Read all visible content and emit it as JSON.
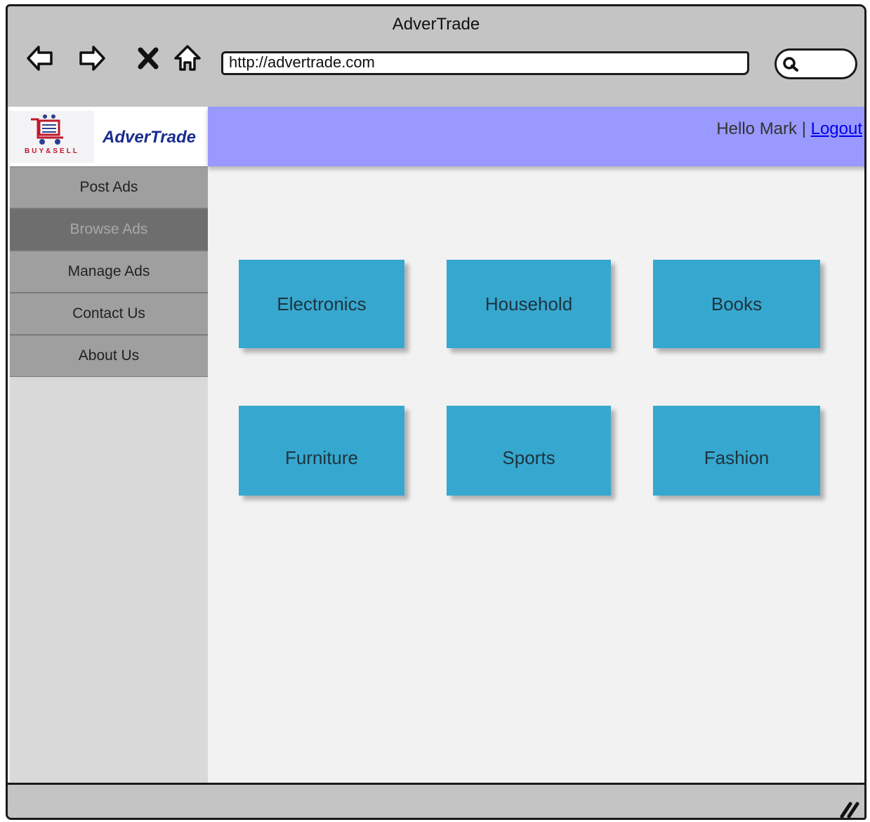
{
  "window": {
    "title": "AdverTrade"
  },
  "browser": {
    "address": "http://advertrade.com",
    "buttons": {
      "back": "back-arrow-icon",
      "forward": "forward-arrow-icon",
      "stop": "close-icon",
      "home": "home-icon",
      "search": "search-icon"
    }
  },
  "header": {
    "logo_text": "BUY&SELL",
    "brand": "AdverTrade",
    "greeting": "Hello Mark | ",
    "logout": "Logout",
    "bar_color": "#9999ff"
  },
  "sidebar": {
    "items": [
      {
        "label": "Post Ads"
      },
      {
        "label": "Browse Ads",
        "active": true
      },
      {
        "label": "Manage Ads"
      },
      {
        "label": "Contact Us"
      },
      {
        "label": "About Us"
      }
    ]
  },
  "categories": [
    {
      "label": "Electronics"
    },
    {
      "label": "Household"
    },
    {
      "label": "Books"
    },
    {
      "label": "Furniture"
    },
    {
      "label": "Sports"
    },
    {
      "label": "Fashion"
    }
  ],
  "colors": {
    "tile": "#36a8cf",
    "chrome": "#c4c4c4",
    "active_nav": "#6e6e6e"
  }
}
